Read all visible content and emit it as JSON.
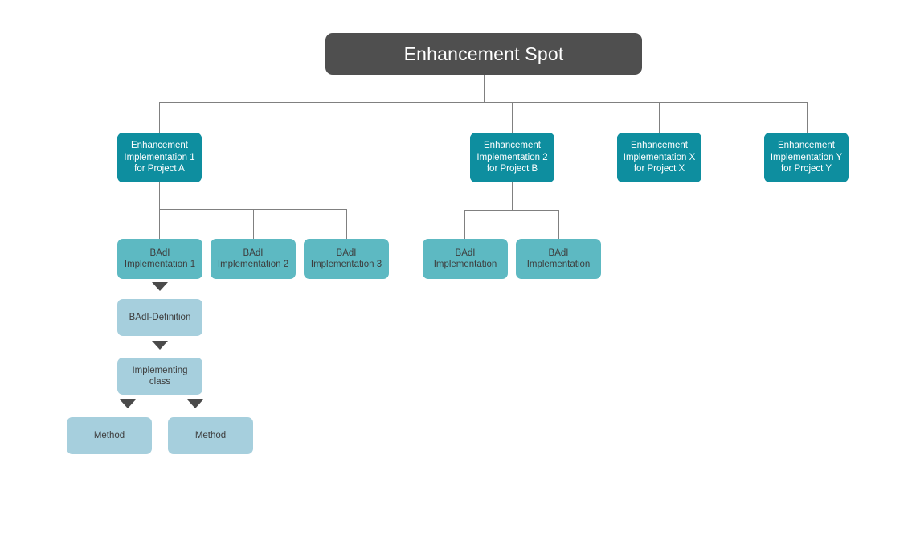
{
  "diagram": {
    "title": "Enhancement Spot",
    "colors": {
      "root_fill": "#4f4f4f",
      "root_text": "#ffffff",
      "level1_fill": "#0e8e9f",
      "level1_text": "#ffffff",
      "level2_fill": "#5db9c2",
      "level3_fill": "#a6cfdd",
      "node_text_dark": "#3d3d3d",
      "connector": "#808080",
      "arrow": "#4a4a4a",
      "background": "#ffffff"
    },
    "root": {
      "label": "Enhancement Spot"
    },
    "enhancement_implementations": [
      {
        "label": "Enhancement\nImplementation 1\nfor Project A"
      },
      {
        "label": "Enhancement\nImplementation 2\nfor Project B"
      },
      {
        "label": "Enhancement\nImplementation X\nfor Project X"
      },
      {
        "label": "Enhancement\nImplementation Y\nfor Project Y"
      }
    ],
    "badi_implementations_project_a": [
      {
        "label": "BAdI\nImplementation 1"
      },
      {
        "label": "BAdI\nImplementation 2"
      },
      {
        "label": "BAdI\nImplementation 3"
      }
    ],
    "badi_implementations_project_b": [
      {
        "label": "BAdI\nImplementation"
      },
      {
        "label": "BAdI\nImplementation"
      }
    ],
    "badi_definition": {
      "label": "BAdI-Definition"
    },
    "implementing_class": {
      "label": "Implementing\nclass"
    },
    "methods": [
      {
        "label": "Method"
      },
      {
        "label": "Method"
      }
    ]
  }
}
